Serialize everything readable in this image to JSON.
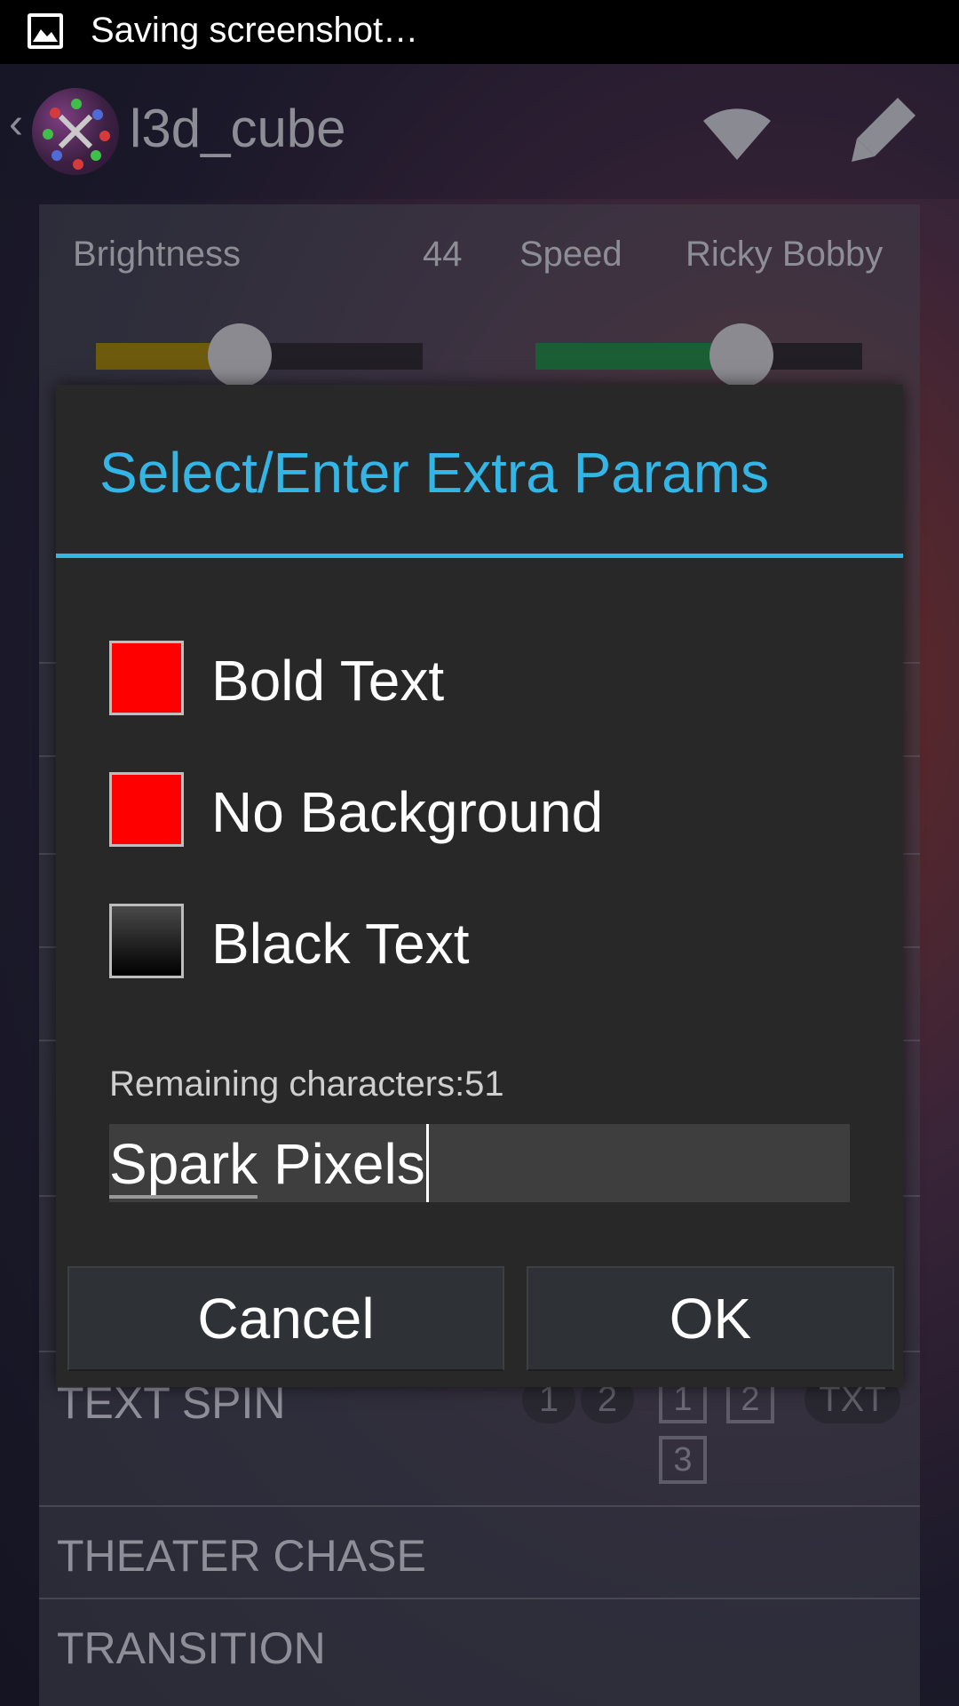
{
  "status_bar": {
    "notification_text": "Saving screenshot…",
    "icon": "image-icon"
  },
  "action_bar": {
    "title": "l3d_cube",
    "icons": [
      "back-icon",
      "app-logo",
      "wifi-icon",
      "edit-icon"
    ]
  },
  "controls": {
    "brightness_label": "Brightness",
    "brightness_value": "44",
    "brightness_level": 0.44,
    "brightness_color": "#6e5a0c",
    "speed_label": "Speed",
    "speed_value": "Ricky Bobby",
    "speed_level": 0.63,
    "speed_color": "#1b5e36"
  },
  "background_list": {
    "items": [
      {
        "label": "TEXT SPIN",
        "pills": [
          "1",
          "2"
        ],
        "boxes": [
          "1",
          "2",
          "3"
        ],
        "tag": "TXT"
      },
      {
        "label": "THEATER CHASE"
      },
      {
        "label": "TRANSITION"
      }
    ]
  },
  "dialog": {
    "title": "Select/Enter Extra Params",
    "title_color": "#33b5e5",
    "checkboxes": [
      {
        "label": "Bold Text",
        "checked": true
      },
      {
        "label": "No Background",
        "checked": true
      },
      {
        "label": "Black Text",
        "checked": false
      }
    ],
    "remaining_label": "Remaining characters:51",
    "input_value": "Spark Pixels",
    "buttons": {
      "cancel": "Cancel",
      "ok": "OK"
    }
  }
}
